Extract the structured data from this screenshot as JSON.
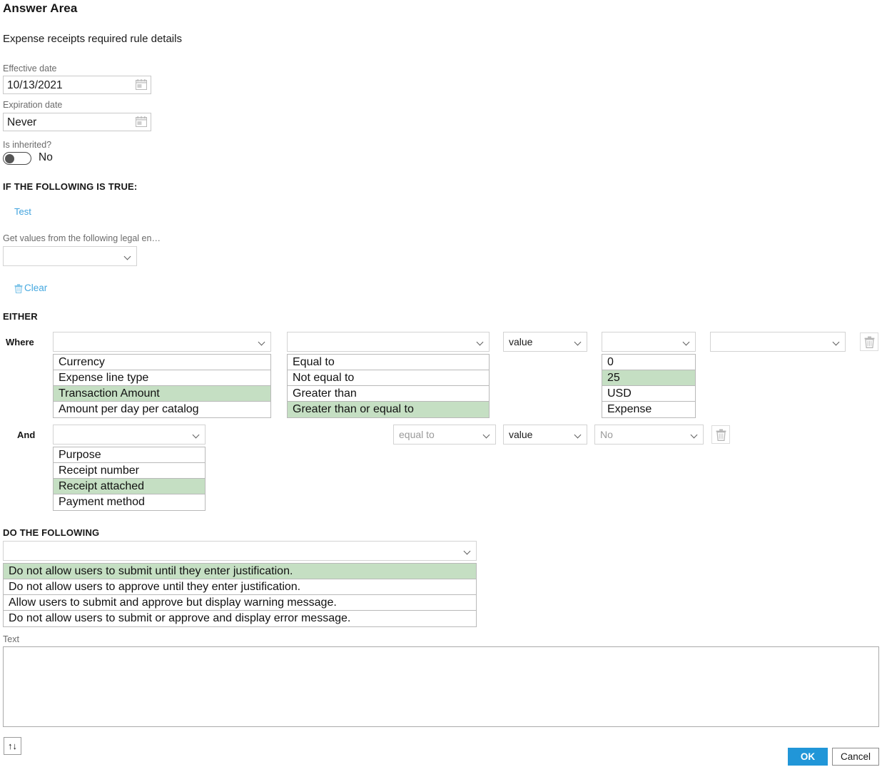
{
  "page": {
    "title": "Answer Area",
    "subtitle": "Expense receipts required rule details"
  },
  "effective_date": {
    "label": "Effective date",
    "value": "10/13/2021",
    "icon": "calendar-icon"
  },
  "expiration_date": {
    "label": "Expiration date",
    "value": "Never",
    "icon": "calendar-icon"
  },
  "is_inherited": {
    "label": "Is inherited?",
    "value": "No",
    "state": "off"
  },
  "conditions": {
    "heading": "IF THE FOLLOWING IS TRUE:",
    "test_link": "Test",
    "legal_entity": {
      "label": "Get values from the following legal en…",
      "value": ""
    },
    "clear_link": "Clear",
    "clear_icon": "trash-icon",
    "either_heading": "EITHER"
  },
  "where_row": {
    "label": "Where",
    "field": {
      "value": "",
      "options": [
        "Currency",
        "Expense line type",
        "Transaction Amount",
        "Amount per day per catalog"
      ],
      "selected": "Transaction Amount"
    },
    "operator": {
      "value": "",
      "options": [
        "Equal to",
        "Not equal to",
        "Greater than",
        "Greater than or equal to"
      ],
      "selected": "Greater than or equal to"
    },
    "comparison_type": {
      "value": "value"
    },
    "amount": {
      "value": "",
      "options": [
        "0",
        "25",
        "USD",
        "Expense"
      ],
      "selected": "25"
    },
    "extra": {
      "value": ""
    },
    "delete_icon": "trash-icon"
  },
  "and_row": {
    "label": "And",
    "field": {
      "value": "",
      "options": [
        "Purpose",
        "Receipt number",
        "Receipt attached",
        "Payment method"
      ],
      "selected": "Receipt attached"
    },
    "operator": {
      "value": "equal to",
      "disabled": true
    },
    "comparison_type": {
      "value": "value"
    },
    "amount": {
      "value": "No",
      "disabled": true
    },
    "delete_icon": "trash-icon"
  },
  "actions": {
    "heading": "DO THE FOLLOWING",
    "select": {
      "value": "",
      "options": [
        "Do not allow users to submit until they enter justification.",
        "Do not allow users to approve until they enter justification.",
        "Allow users to submit and approve but display warning message.",
        "Do not allow users to submit or approve and display error message."
      ],
      "selected": "Do not allow users to submit until they enter justification."
    }
  },
  "text_field": {
    "label": "Text",
    "value": ""
  },
  "sort_button": {
    "icon": "sort-updown-icon",
    "glyph": "↑↓"
  },
  "footer": {
    "ok_label": "OK",
    "cancel_label": "Cancel"
  },
  "colors": {
    "selected_row": "#c5dfc3",
    "accent": "#2196d8",
    "link": "#3fa2dd"
  }
}
